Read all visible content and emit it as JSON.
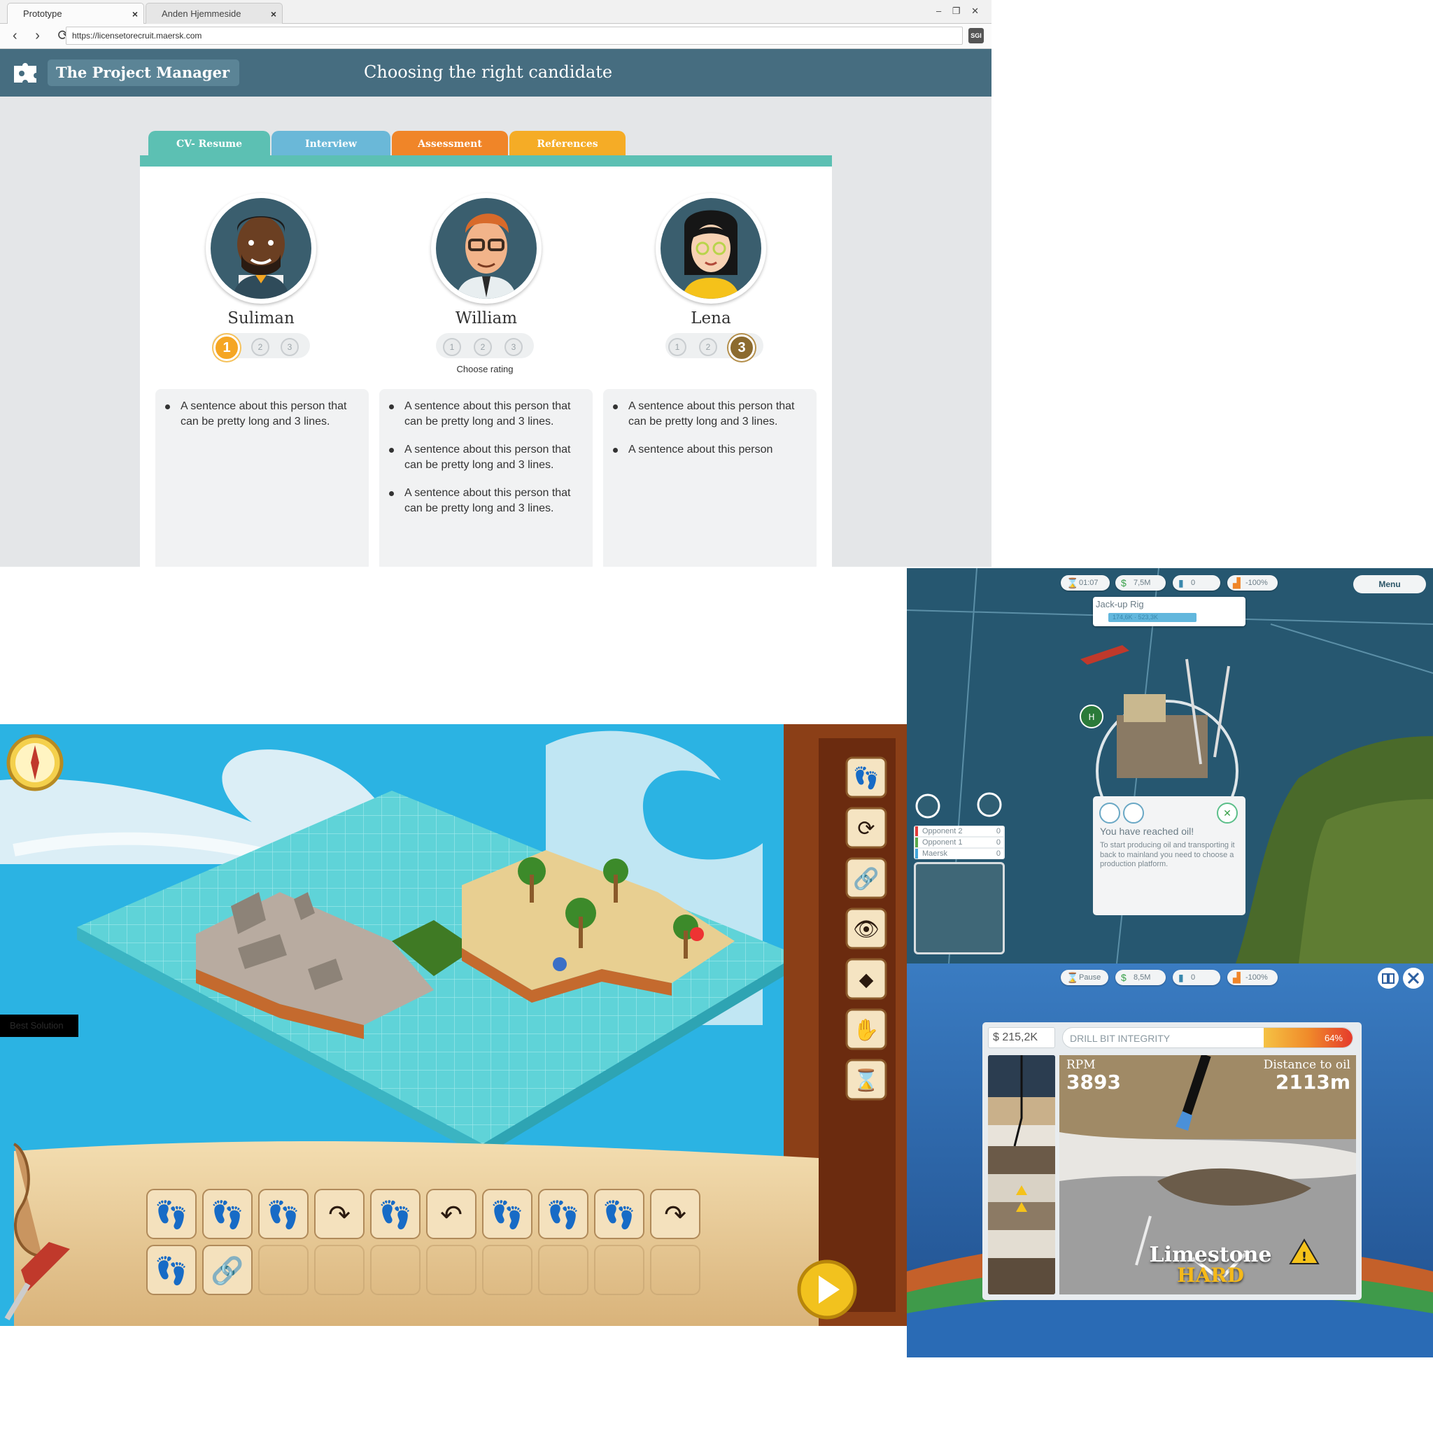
{
  "browser": {
    "tabs": [
      {
        "label": "Prototype",
        "close": "×"
      },
      {
        "label": "Anden Hjemmeside",
        "close": "×"
      }
    ],
    "window_controls": "– ❐ ✕",
    "nav": "‹ › ⟳",
    "url": "https://licensetorecruit.maersk.com",
    "extension_badge": "SGI"
  },
  "app": {
    "brand": "The Project Manager",
    "page_title": "Choosing the right candidate",
    "tabs": [
      {
        "label": "CV- Resume",
        "color": "#5cc0b3"
      },
      {
        "label": "Interview",
        "color": "#6ab8d8"
      },
      {
        "label": "Assessment",
        "color": "#f08528"
      },
      {
        "label": "References",
        "color": "#f5ac26"
      }
    ],
    "rating_prompt": "Choose rating",
    "candidates": [
      {
        "name": "Suliman",
        "selected": "1",
        "ratings": [
          "1",
          "2",
          "3"
        ],
        "bullets": [
          "A sentence about this person that can be pretty long and 3 lines."
        ]
      },
      {
        "name": "William",
        "selected": "",
        "ratings": [
          "1",
          "2",
          "3"
        ],
        "bullets": [
          "A sentence about this person that can be pretty long and 3 lines.",
          "A sentence about this person that can be pretty long and 3 lines.",
          "A sentence about this person that can be pretty long and 3 lines."
        ]
      },
      {
        "name": "Lena",
        "selected": "3",
        "ratings": [
          "1",
          "2",
          "3"
        ],
        "bullets": [
          "A sentence about this person that can be pretty long and 3 lines.",
          "A sentence about this person"
        ]
      }
    ]
  },
  "game": {
    "best_solution": "Best Solution",
    "command_palette": [
      "footsteps-icon",
      "rotate-icon",
      "link-icon",
      "eye-icon",
      "turn-sign-icon",
      "hand-icon",
      "hourglass-icon"
    ],
    "program_row1": [
      "footsteps-icon",
      "footsteps-icon",
      "footsteps-icon",
      "turn-right-icon",
      "footsteps-icon",
      "turn-left-icon",
      "footsteps-icon",
      "footsteps-icon",
      "footsteps-icon",
      "turn-right-icon"
    ],
    "program_row2": [
      "footsteps-icon",
      "link-icon"
    ]
  },
  "rig": {
    "hud": [
      {
        "icon": "hourglass-icon",
        "value": "01:07"
      },
      {
        "icon": "dollar-icon",
        "value": "7,5M"
      },
      {
        "icon": "barrel-icon",
        "value": "0"
      },
      {
        "icon": "reputation-icon",
        "value": "-100%"
      }
    ],
    "menu": "Menu",
    "rig_name": "Jack-up Rig",
    "rig_progress": "174,6K · 523,3K",
    "popup_title": "You have reached oil!",
    "popup_body": "To start producing oil and transporting it back to mainland you need to choose a production platform.",
    "scoreboard": [
      {
        "name": "Opponent 2",
        "value": "0",
        "color": "#e23b3b"
      },
      {
        "name": "Opponent 1",
        "value": "0",
        "color": "#5aa84a"
      },
      {
        "name": "Maersk",
        "value": "0",
        "color": "#42a5d9"
      }
    ]
  },
  "drill": {
    "hud": [
      {
        "icon": "hourglass-icon",
        "value": "Pause"
      },
      {
        "icon": "dollar-icon",
        "value": "8,5M"
      },
      {
        "icon": "barrel-icon",
        "value": "0"
      },
      {
        "icon": "reputation-icon",
        "value": "-100%"
      }
    ],
    "money": "$ 215,2K",
    "integrity_label": "DRILL BIT INTEGRITY",
    "integrity_pct": "64%",
    "integrity_value": 0.64,
    "rpm_label": "RPM",
    "rpm": "3893",
    "distance_label": "Distance to oil",
    "distance": "2113m",
    "rock": "Limestone",
    "hardness": "HARD"
  }
}
